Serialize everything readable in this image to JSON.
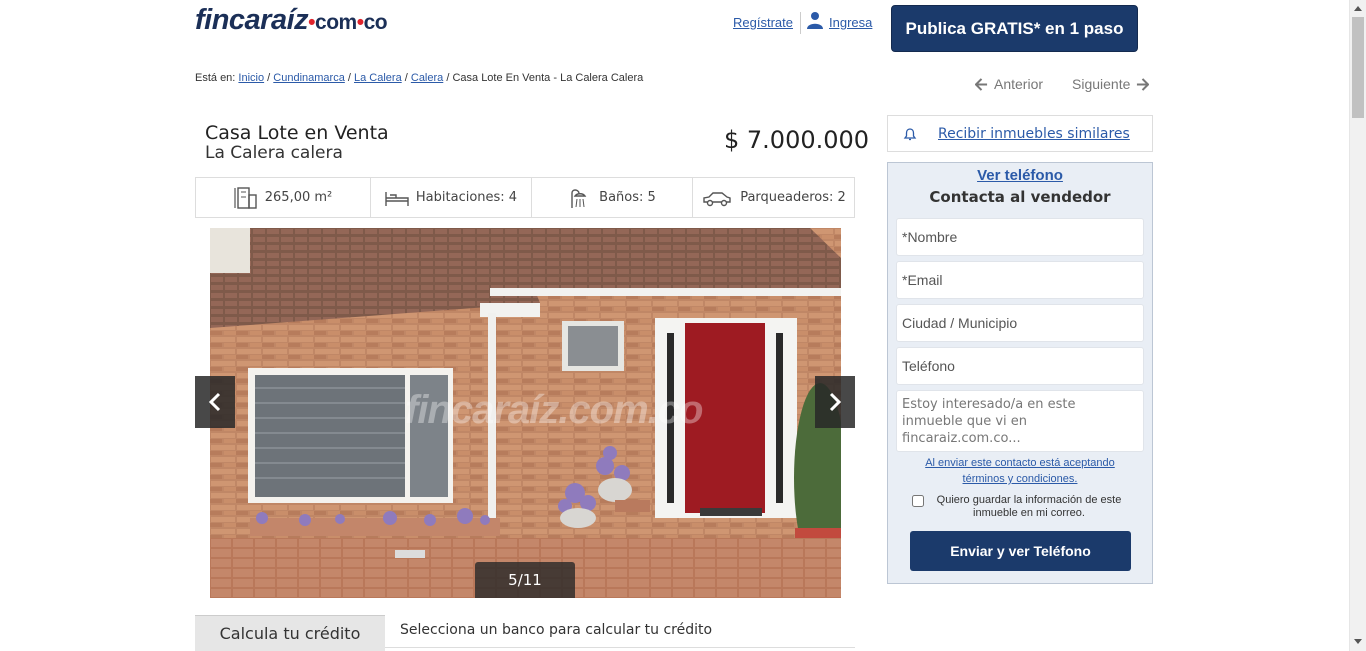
{
  "header": {
    "logo_main": "fincaraíz",
    "logo_com": "com",
    "logo_co": "co",
    "register_label": "Regístrate",
    "login_label": "Ingresa",
    "publish_label": "Publica GRATIS* en 1 paso"
  },
  "breadcrumb": {
    "prefix": "Está en:",
    "items": [
      "Inicio",
      "Cundinamarca",
      "La Calera",
      "Calera"
    ],
    "current": "Casa Lote En Venta - La Calera Calera"
  },
  "pager": {
    "prev_label": "Anterior",
    "next_label": "Siguiente"
  },
  "listing": {
    "title": "Casa Lote en Venta",
    "subtitle": "La Calera calera",
    "price": "$ 7.000.000",
    "features": [
      {
        "icon": "area-icon",
        "text": "265,00 m²"
      },
      {
        "icon": "bed-icon",
        "text": "Habitaciones: 4"
      },
      {
        "icon": "shower-icon",
        "text": "Baños: 5"
      },
      {
        "icon": "car-icon",
        "text": "Parqueaderos: 2"
      }
    ]
  },
  "gallery": {
    "counter": "5/11",
    "watermark": "fincaraíz.com.co"
  },
  "credit": {
    "tab_label": "Calcula tu crédito",
    "prompt": "Selecciona un banco para calcular tu crédito"
  },
  "similar": {
    "label": "Recibir inmuebles similares"
  },
  "contact": {
    "view_phone": "Ver teléfono",
    "title": "Contacta al vendedor",
    "name_placeholder": "*Nombre",
    "email_placeholder": "*Email",
    "city_placeholder": "Ciudad / Municipio",
    "phone_placeholder": "Teléfono",
    "message_placeholder": "Estoy interesado/a en este inmueble que vi en fincaraiz.com.co...",
    "terms_line1": "Al enviar este contacto está aceptando",
    "terms_line2": "términos y condiciones.",
    "save_info": "Quiero guardar la información de este inmueble en mi correo.",
    "submit_label": "Enviar y ver Teléfono"
  },
  "colors": {
    "brand_navy": "#1b3a6b",
    "link_blue": "#2b5aa8",
    "logo_red": "#e0242c",
    "contact_bg": "#e9eef5"
  }
}
